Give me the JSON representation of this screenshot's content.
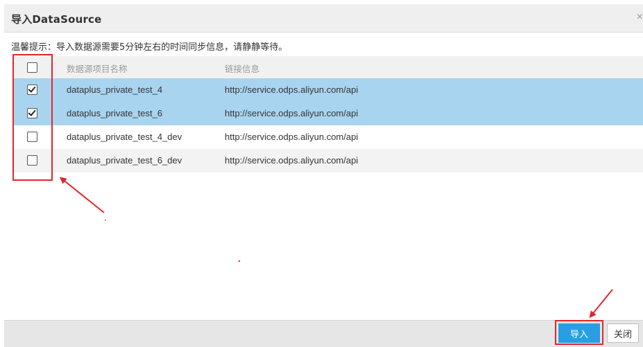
{
  "dialog": {
    "title": "导入DataSource",
    "close_icon": "close-icon",
    "tip": "温馨提示：导入数据源需要5分钟左右的时间同步信息，请静静等待。"
  },
  "table": {
    "columns": [
      "数据源项目名称",
      "链接信息"
    ],
    "rows": [
      {
        "name": "dataplus_private_test_4",
        "link": "http://service.odps.aliyun.com/api",
        "checked": true
      },
      {
        "name": "dataplus_private_test_6",
        "link": "http://service.odps.aliyun.com/api",
        "checked": true
      },
      {
        "name": "dataplus_private_test_4_dev",
        "link": "http://service.odps.aliyun.com/api",
        "checked": false
      },
      {
        "name": "dataplus_private_test_6_dev",
        "link": "http://service.odps.aliyun.com/api",
        "checked": false
      }
    ]
  },
  "footer": {
    "import_label": "导入",
    "close_label": "关闭"
  },
  "colors": {
    "selected_row": "#a9d4f0",
    "primary_button": "#2a9ee2",
    "annotation_red": "#e0262b"
  }
}
